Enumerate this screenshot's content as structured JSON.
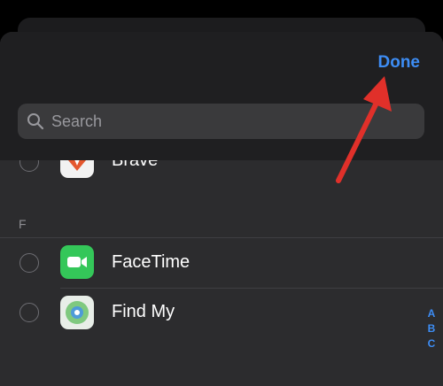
{
  "header": {
    "done_label": "Done"
  },
  "search": {
    "placeholder": "Search"
  },
  "apps": [
    {
      "name": "Brave",
      "icon": "brave-icon"
    },
    {
      "name": "FaceTime",
      "icon": "facetime-icon"
    },
    {
      "name": "Find My",
      "icon": "findmy-icon"
    }
  ],
  "sections": [
    {
      "letter": "F"
    }
  ],
  "index_letters": [
    "A",
    "B",
    "C"
  ],
  "colors": {
    "accent": "#3d8df5",
    "arrow": "#e0302a",
    "facetime": "#34c759"
  }
}
